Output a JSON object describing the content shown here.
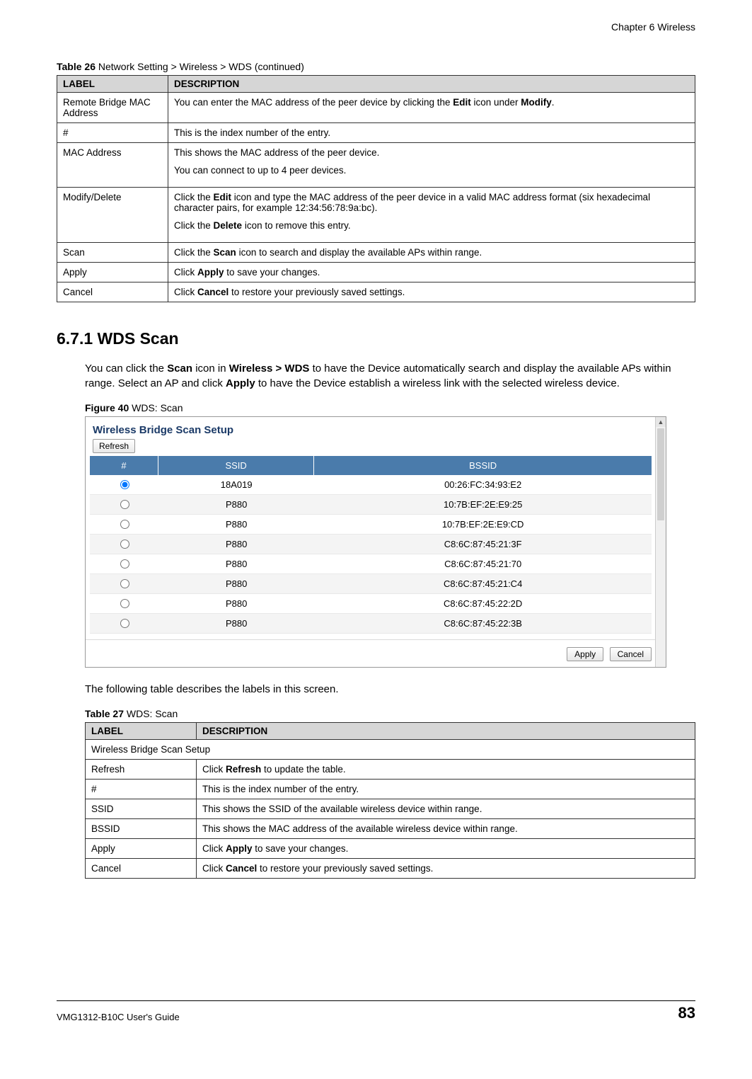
{
  "header": {
    "chapter": "Chapter 6 Wireless"
  },
  "table26": {
    "caption_prefix": "Table 26",
    "caption_rest": "   Network Setting > Wireless > WDS (continued)",
    "head_label": "LABEL",
    "head_desc": "DESCRIPTION",
    "rows": [
      {
        "label": "Remote Bridge MAC Address",
        "desc_parts": [
          {
            "t": "You can enter the MAC address of the peer device by clicking the "
          },
          {
            "b": "Edit"
          },
          {
            "t": " icon under "
          },
          {
            "b": "Modify"
          },
          {
            "t": "."
          }
        ]
      },
      {
        "label": "#",
        "desc_parts": [
          {
            "t": "This is the index number of the entry."
          }
        ]
      },
      {
        "label": "MAC Address",
        "desc_paragraphs": [
          [
            {
              "t": "This shows the MAC address of the peer device."
            }
          ],
          [
            {
              "t": "You can connect to up to 4 peer devices."
            }
          ]
        ]
      },
      {
        "label": "Modify/Delete",
        "desc_paragraphs": [
          [
            {
              "t": "Click the "
            },
            {
              "b": "Edit"
            },
            {
              "t": " icon and type the MAC address of the peer device in a valid MAC address format (six hexadecimal character pairs, for example 12:34:56:78:9a:bc)."
            }
          ],
          [
            {
              "t": "Click the "
            },
            {
              "b": "Delete"
            },
            {
              "t": " icon to remove this entry."
            }
          ]
        ]
      },
      {
        "label": "Scan",
        "desc_parts": [
          {
            "t": "Click the "
          },
          {
            "b": "Scan"
          },
          {
            "t": " icon to search and display the available APs within range."
          }
        ]
      },
      {
        "label": "Apply",
        "desc_parts": [
          {
            "t": "Click "
          },
          {
            "b": "Apply"
          },
          {
            "t": " to save your changes."
          }
        ]
      },
      {
        "label": "Cancel",
        "desc_parts": [
          {
            "t": "Click "
          },
          {
            "b": "Cancel"
          },
          {
            "t": " to restore your previously saved settings."
          }
        ]
      }
    ]
  },
  "section": {
    "heading": "6.7.1  WDS Scan",
    "para_parts": [
      {
        "t": "You can click the "
      },
      {
        "b": "Scan"
      },
      {
        "t": " icon in "
      },
      {
        "b": "Wireless >  WDS"
      },
      {
        "t": " to have the Device automatically search and display the available APs within range. Select an AP and click "
      },
      {
        "b": "Apply"
      },
      {
        "t": " to have the Device establish a wireless link with the selected wireless device."
      }
    ]
  },
  "figure": {
    "caption_prefix": "Figure 40",
    "caption_rest": "   WDS: Scan",
    "panel_title": "Wireless Bridge Scan Setup",
    "refresh": "Refresh",
    "columns": {
      "num": "#",
      "ssid": "SSID",
      "bssid": "BSSID"
    },
    "rows": [
      {
        "selected": true,
        "ssid": "18A019",
        "bssid": "00:26:FC:34:93:E2"
      },
      {
        "selected": false,
        "ssid": "P880",
        "bssid": "10:7B:EF:2E:E9:25"
      },
      {
        "selected": false,
        "ssid": "P880",
        "bssid": "10:7B:EF:2E:E9:CD"
      },
      {
        "selected": false,
        "ssid": "P880",
        "bssid": "C8:6C:87:45:21:3F"
      },
      {
        "selected": false,
        "ssid": "P880",
        "bssid": "C8:6C:87:45:21:70"
      },
      {
        "selected": false,
        "ssid": "P880",
        "bssid": "C8:6C:87:45:21:C4"
      },
      {
        "selected": false,
        "ssid": "P880",
        "bssid": "C8:6C:87:45:22:2D"
      },
      {
        "selected": false,
        "ssid": "P880",
        "bssid": "C8:6C:87:45:22:3B"
      }
    ],
    "apply": "Apply",
    "cancel": "Cancel"
  },
  "table27_intro": "The following table describes the labels in this screen.",
  "table27": {
    "caption_prefix": "Table 27",
    "caption_rest": "   WDS: Scan",
    "head_label": "LABEL",
    "head_desc": "DESCRIPTION",
    "subhead": "Wireless Bridge Scan Setup",
    "rows": [
      {
        "label": "Refresh",
        "desc_parts": [
          {
            "t": "Click "
          },
          {
            "b": "Refresh"
          },
          {
            "t": " to update the table."
          }
        ]
      },
      {
        "label": "#",
        "desc_parts": [
          {
            "t": "This is the index number of the entry."
          }
        ]
      },
      {
        "label": "SSID",
        "desc_parts": [
          {
            "t": "This shows the SSID of the available wireless device within range."
          }
        ]
      },
      {
        "label": "BSSID",
        "desc_parts": [
          {
            "t": "This shows the MAC address of the available wireless device within range."
          }
        ]
      },
      {
        "label": "Apply",
        "desc_parts": [
          {
            "t": "Click "
          },
          {
            "b": "Apply"
          },
          {
            "t": " to save your changes."
          }
        ]
      },
      {
        "label": "Cancel",
        "desc_parts": [
          {
            "t": "Click "
          },
          {
            "b": "Cancel"
          },
          {
            "t": " to restore your previously saved settings."
          }
        ]
      }
    ]
  },
  "footer": {
    "left": "VMG1312-B10C User's Guide",
    "right": "83"
  }
}
